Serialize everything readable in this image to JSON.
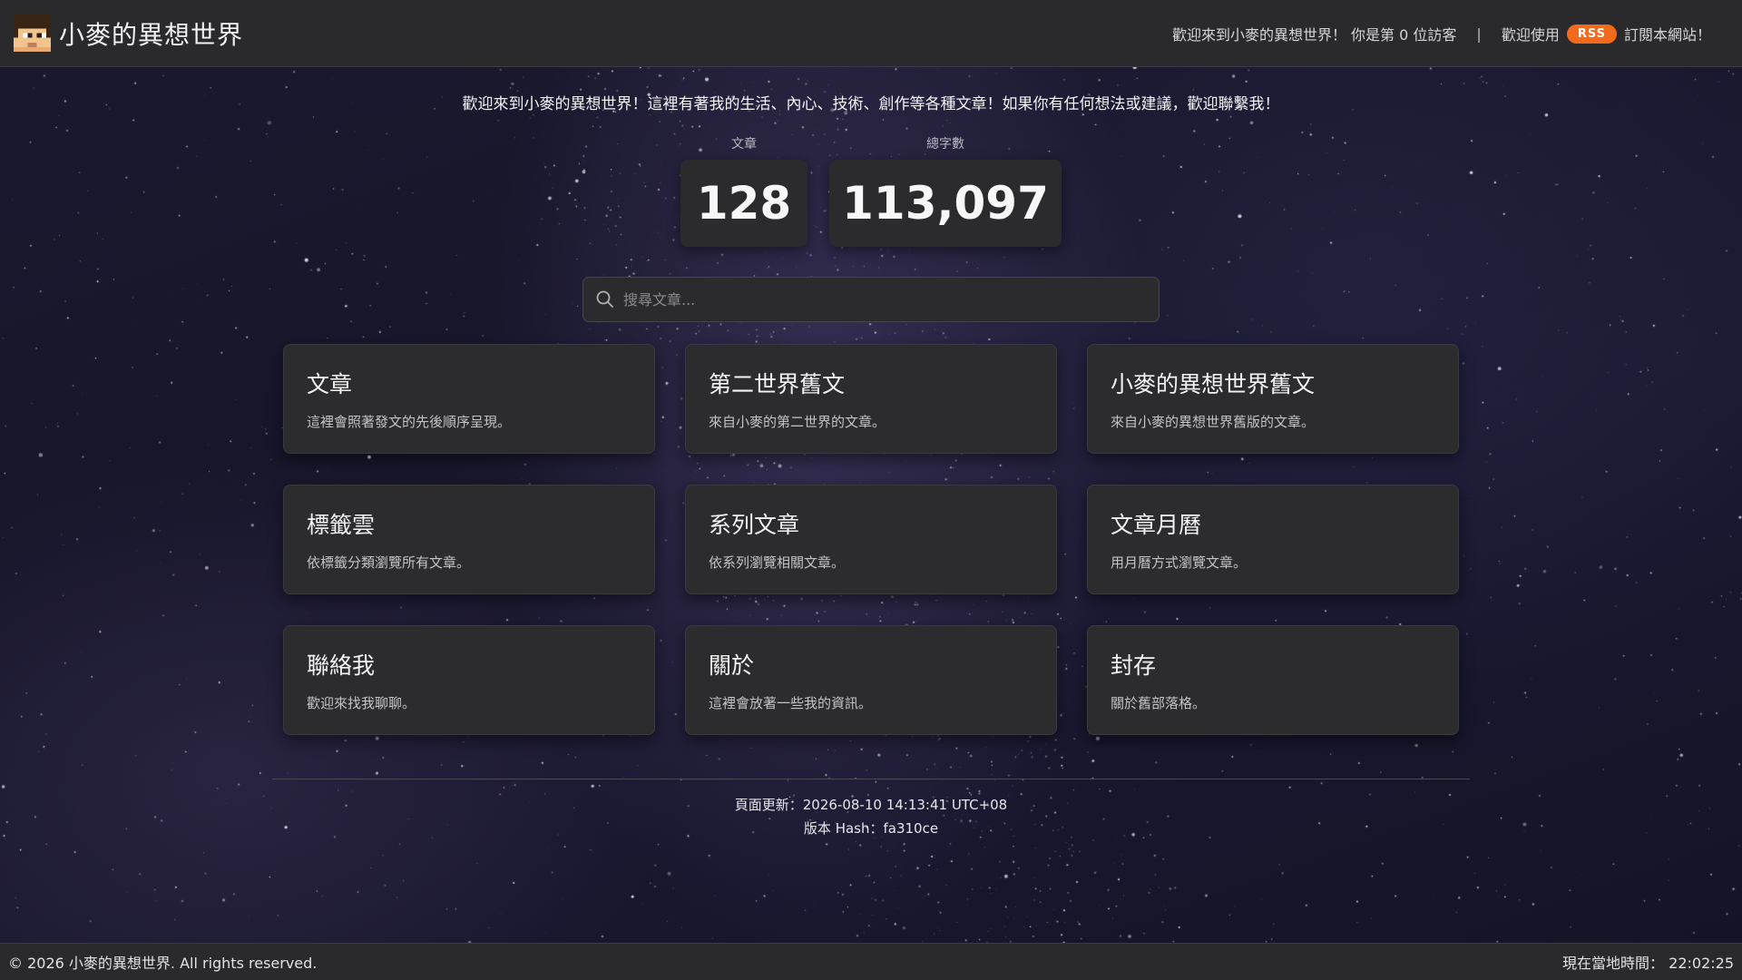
{
  "header": {
    "site_title": "小麥的異想世界",
    "visitor_text": "歡迎來到小麥的異想世界！ 你是第 0 位訪客",
    "separator": "|",
    "rss_prefix": "歡迎使用",
    "rss_badge": "RSS",
    "rss_suffix": "訂閱本網站！"
  },
  "intro": "歡迎來到小麥的異想世界！這裡有著我的生活、內心、技術、創作等各種文章！如果你有任何想法或建議，歡迎聯繫我！",
  "stats": {
    "articles": {
      "label": "文章",
      "value": "128"
    },
    "words": {
      "label": "總字數",
      "value": "113,097"
    }
  },
  "search": {
    "placeholder": "搜尋文章..."
  },
  "cards": [
    {
      "title": "文章",
      "desc": "這裡會照著發文的先後順序呈現。"
    },
    {
      "title": "第二世界舊文",
      "desc": "來自小麥的第二世界的文章。"
    },
    {
      "title": "小麥的異想世界舊文",
      "desc": "來自小麥的異想世界舊版的文章。"
    },
    {
      "title": "標籤雲",
      "desc": "依標籤分類瀏覽所有文章。"
    },
    {
      "title": "系列文章",
      "desc": "依系列瀏覽相關文章。"
    },
    {
      "title": "文章月曆",
      "desc": "用月曆方式瀏覽文章。"
    },
    {
      "title": "聯絡我",
      "desc": "歡迎來找我聊聊。"
    },
    {
      "title": "關於",
      "desc": "這裡會放著一些我的資訊。"
    },
    {
      "title": "封存",
      "desc": "關於舊部落格。"
    }
  ],
  "meta": {
    "updated": "頁面更新：2026-08-10 14:13:41 UTC+08",
    "hash": "版本 Hash：fa310ce"
  },
  "footer": {
    "copyright": "© 2026 小麥的異想世界. All rights reserved.",
    "local_time": "現在當地時間： 22:02:25"
  },
  "colors": {
    "rss": "#f26b1d",
    "bar": "#2a2a2d",
    "card": "#2c2c2f",
    "background": "#1b1930"
  },
  "icons": {
    "avatar": "pixel-avatar-icon",
    "search": "search-icon"
  }
}
